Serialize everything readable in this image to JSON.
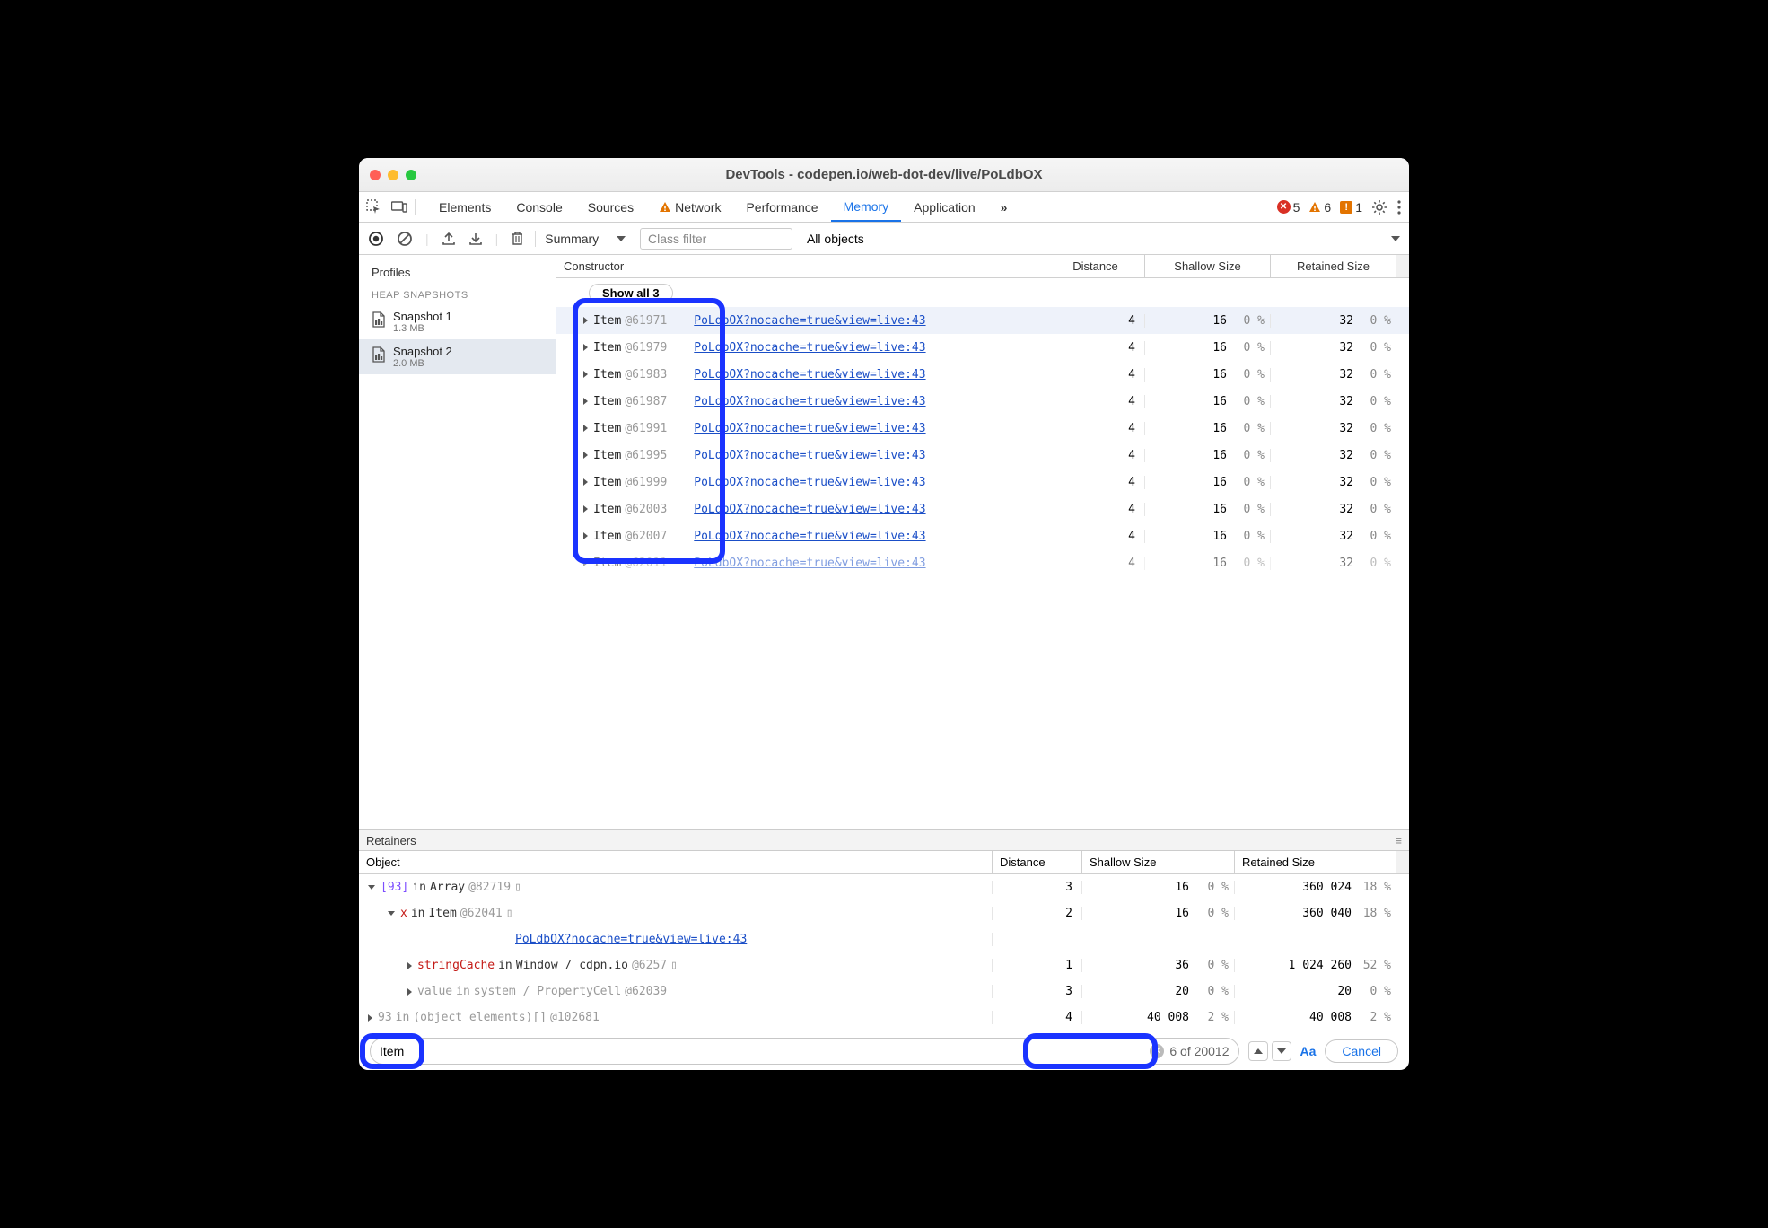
{
  "window_title": "DevTools - codepen.io/web-dot-dev/live/PoLdbOX",
  "tabs": {
    "elements": "Elements",
    "console": "Console",
    "sources": "Sources",
    "network": "Network",
    "performance": "Performance",
    "memory": "Memory",
    "application": "Application",
    "overflow": "»"
  },
  "badges": {
    "errors": "5",
    "warnings": "6",
    "issues": "1"
  },
  "toolbar": {
    "summary": "Summary",
    "class_filter_placeholder": "Class filter",
    "all_objects": "All objects"
  },
  "sidebar": {
    "profiles": "Profiles",
    "heap": "HEAP SNAPSHOTS",
    "snaps": [
      {
        "name": "Snapshot 1",
        "size": "1.3 MB"
      },
      {
        "name": "Snapshot 2",
        "size": "2.0 MB"
      }
    ]
  },
  "header": {
    "constructor": "Constructor",
    "distance": "Distance",
    "shallow": "Shallow Size",
    "retained": "Retained Size"
  },
  "show_all": "Show all 3",
  "rows": [
    {
      "name": "Item",
      "id": "@61971",
      "link": "PoLdbOX?nocache=true&view=live:43",
      "d": "4",
      "sv": "16",
      "sp": "0 %",
      "rv": "32",
      "rp": "0 %",
      "sel": true
    },
    {
      "name": "Item",
      "id": "@61979",
      "link": "PoLdbOX?nocache=true&view=live:43",
      "d": "4",
      "sv": "16",
      "sp": "0 %",
      "rv": "32",
      "rp": "0 %"
    },
    {
      "name": "Item",
      "id": "@61983",
      "link": "PoLdbOX?nocache=true&view=live:43",
      "d": "4",
      "sv": "16",
      "sp": "0 %",
      "rv": "32",
      "rp": "0 %"
    },
    {
      "name": "Item",
      "id": "@61987",
      "link": "PoLdbOX?nocache=true&view=live:43",
      "d": "4",
      "sv": "16",
      "sp": "0 %",
      "rv": "32",
      "rp": "0 %"
    },
    {
      "name": "Item",
      "id": "@61991",
      "link": "PoLdbOX?nocache=true&view=live:43",
      "d": "4",
      "sv": "16",
      "sp": "0 %",
      "rv": "32",
      "rp": "0 %"
    },
    {
      "name": "Item",
      "id": "@61995",
      "link": "PoLdbOX?nocache=true&view=live:43",
      "d": "4",
      "sv": "16",
      "sp": "0 %",
      "rv": "32",
      "rp": "0 %"
    },
    {
      "name": "Item",
      "id": "@61999",
      "link": "PoLdbOX?nocache=true&view=live:43",
      "d": "4",
      "sv": "16",
      "sp": "0 %",
      "rv": "32",
      "rp": "0 %"
    },
    {
      "name": "Item",
      "id": "@62003",
      "link": "PoLdbOX?nocache=true&view=live:43",
      "d": "4",
      "sv": "16",
      "sp": "0 %",
      "rv": "32",
      "rp": "0 %"
    },
    {
      "name": "Item",
      "id": "@62007",
      "link": "PoLdbOX?nocache=true&view=live:43",
      "d": "4",
      "sv": "16",
      "sp": "0 %",
      "rv": "32",
      "rp": "0 %"
    },
    {
      "name": "Item",
      "id": "@62011",
      "link": "PoLdbOX?nocache=true&view=live:43",
      "d": "4",
      "sv": "16",
      "sp": "0 %",
      "rv": "32",
      "rp": "0 %",
      "cut": true
    }
  ],
  "retainers": {
    "title": "Retainers",
    "header": {
      "object": "Object",
      "distance": "Distance",
      "shallow": "Shallow Size",
      "retained": "Retained Size"
    },
    "rows": [
      {
        "indent": 0,
        "tri": "down",
        "idx": "[93]",
        "in": "in",
        "type": "Array",
        "id": "@82719",
        "sq": true,
        "d": "3",
        "sv": "16",
        "sp": "0 %",
        "rv": "360 024",
        "rp": "18 %"
      },
      {
        "indent": 1,
        "tri": "down",
        "key": "x",
        "in": "in",
        "type": "Item",
        "id": "@62041",
        "sq": true,
        "d": "2",
        "sv": "16",
        "sp": "0 %",
        "rv": "360 040",
        "rp": "18 %"
      },
      {
        "indent": 2,
        "linkonly": "PoLdbOX?nocache=true&view=live:43"
      },
      {
        "indent": 2,
        "tri": "right",
        "key": "stringCache",
        "in": "in",
        "type": "Window / cdpn.io",
        "id": "@6257",
        "sq": true,
        "d": "1",
        "sv": "36",
        "sp": "0 %",
        "rv": "1 024 260",
        "rp": "52 %"
      },
      {
        "indent": 2,
        "tri": "right",
        "faded": true,
        "key": "value",
        "in": "in",
        "type": "system / PropertyCell",
        "id": "@62039",
        "d": "3",
        "sv": "20",
        "sp": "0 %",
        "rv": "20",
        "rp": "0 %"
      },
      {
        "indent": 0,
        "tri": "right",
        "faded": true,
        "idx": "93",
        "in": "in",
        "type": "(object elements)[]",
        "id": "@102681",
        "d": "4",
        "sv": "40 008",
        "sp": "2 %",
        "rv": "40 008",
        "rp": "2 %"
      }
    ]
  },
  "search": {
    "value": "Item",
    "count": "6 of 20012",
    "aa": "Aa",
    "cancel": "Cancel"
  }
}
